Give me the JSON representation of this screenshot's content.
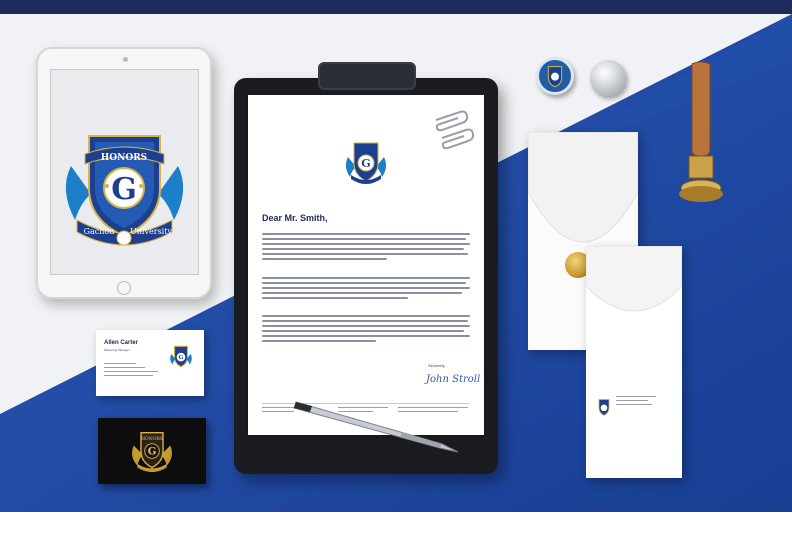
{
  "scene": {
    "colors": {
      "brand_blue": "#1f4fa6",
      "navy": "#1e2b55",
      "gold": "#c79a2c",
      "background": "#f1f2f5"
    }
  },
  "tablet": {
    "logo": {
      "top_text": "HONORS",
      "letter": "G",
      "ribbon_left": "Gachon",
      "ribbon_right": "University"
    }
  },
  "letter": {
    "greeting": "Dear Mr. Smith,",
    "closing": "Sincerely,",
    "signature": "John Stroll"
  },
  "business_card": {
    "name": "Allen Carter",
    "role": "Marketing Manager"
  },
  "black_card": {
    "logo_top_text": "HONORS",
    "logo_letter": "G"
  },
  "icons": {
    "crest": "crest-logo-icon",
    "paperclip": "paperclip-icon",
    "pen": "pen-icon",
    "stamp": "wax-stamp-icon"
  }
}
